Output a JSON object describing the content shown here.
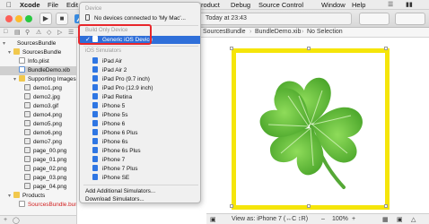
{
  "menubar": {
    "apple": "",
    "items": [
      "Xcode",
      "File",
      "Edit",
      "Product",
      "Debug",
      "Source Control",
      "Window",
      "Help"
    ],
    "status_icons": [
      "wifi-icon",
      "battery-icon"
    ]
  },
  "toolbar": {
    "activity": "Today at 23:43",
    "scheme_icon": "xcode-app-icon"
  },
  "jumpbar": {
    "parts": [
      "SourcesBundle",
      "BundleDemo.xib",
      "No Selection"
    ]
  },
  "navigator": {
    "rows": [
      {
        "label": "SourcesBundle",
        "icon": "project",
        "indent": 0,
        "selected": false,
        "red": false
      },
      {
        "label": "SourcesBundle",
        "icon": "folder",
        "indent": 1,
        "selected": false,
        "red": false
      },
      {
        "label": "Info.plist",
        "icon": "file",
        "indent": 2,
        "selected": false,
        "red": false
      },
      {
        "label": "BundleDemo.xib",
        "icon": "xib",
        "indent": 2,
        "selected": true,
        "red": false
      },
      {
        "label": "Supporting Images",
        "icon": "folder",
        "indent": 2,
        "selected": false,
        "red": false
      },
      {
        "label": "demo1.png",
        "icon": "png",
        "indent": 3,
        "selected": false,
        "red": false
      },
      {
        "label": "demo2.jpg",
        "icon": "png",
        "indent": 3,
        "selected": false,
        "red": false
      },
      {
        "label": "demo3.gif",
        "icon": "png",
        "indent": 3,
        "selected": false,
        "red": false
      },
      {
        "label": "demo4.png",
        "icon": "png",
        "indent": 3,
        "selected": false,
        "red": false
      },
      {
        "label": "demo5.png",
        "icon": "png",
        "indent": 3,
        "selected": false,
        "red": false
      },
      {
        "label": "demo6.png",
        "icon": "png",
        "indent": 3,
        "selected": false,
        "red": false
      },
      {
        "label": "demo7.png",
        "icon": "png",
        "indent": 3,
        "selected": false,
        "red": false
      },
      {
        "label": "page_00.png",
        "icon": "png",
        "indent": 3,
        "selected": false,
        "red": false
      },
      {
        "label": "page_01.png",
        "icon": "png",
        "indent": 3,
        "selected": false,
        "red": false
      },
      {
        "label": "page_02.png",
        "icon": "png",
        "indent": 3,
        "selected": false,
        "red": false
      },
      {
        "label": "page_03.png",
        "icon": "png",
        "indent": 3,
        "selected": false,
        "red": false
      },
      {
        "label": "page_04.png",
        "icon": "png",
        "indent": 3,
        "selected": false,
        "red": false
      },
      {
        "label": "Products",
        "icon": "folder",
        "indent": 1,
        "selected": false,
        "red": false
      },
      {
        "label": "SourcesBundle.bundle",
        "icon": "file",
        "indent": 2,
        "selected": false,
        "red": true
      }
    ]
  },
  "dropdown": {
    "device_header": "Device",
    "no_devices": "No devices connected to 'My Mac'...",
    "build_only_header": "Build Only Device",
    "generic_device": "Generic iOS Device",
    "simulators_header": "iOS Simulators",
    "simulators": [
      "iPad Air",
      "iPad Air 2",
      "iPad Pro (9.7 inch)",
      "iPad Pro (12.9 inch)",
      "iPad Retina",
      "iPhone 5",
      "iPhone 5s",
      "iPhone 6",
      "iPhone 6 Plus",
      "iPhone 6s",
      "iPhone 6s Plus",
      "iPhone 7",
      "iPhone 7 Plus",
      "iPhone SE"
    ],
    "add_simulators": "Add Additional Simulators...",
    "download_simulators": "Download Simulators..."
  },
  "bottombar": {
    "view_as_label": "View as: iPhone 7 (↔C ↕R)",
    "zoom": "100%"
  },
  "colors": {
    "selection": "#2f6fd9",
    "frame_border": "#f5e50a",
    "highlight_box": "#e8262b",
    "clover": "#6cc83a"
  }
}
